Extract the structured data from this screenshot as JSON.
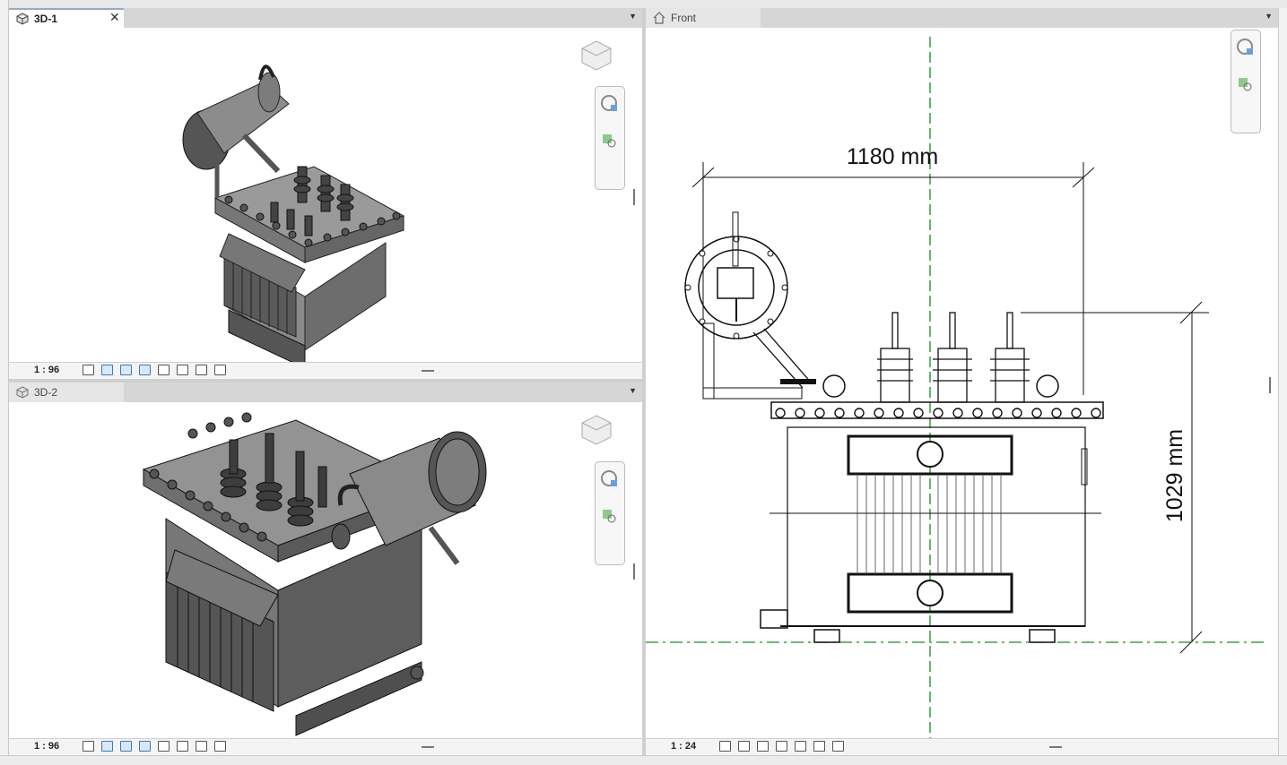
{
  "panes": {
    "top_left": {
      "tab_title": "3D-1",
      "scale": "1 : 96"
    },
    "bottom_left": {
      "tab_title": "3D-2",
      "scale": "1 : 96"
    },
    "right": {
      "tab_title": "Front",
      "scale": "1 : 24"
    }
  },
  "drawing": {
    "width_dimension": "1180 mm",
    "height_dimension": "1029 mm"
  },
  "icons": [
    "3d-view-icon",
    "front-view-icon",
    "close-icon",
    "view-cube-icon",
    "steering-wheel-icon",
    "zoom-icon"
  ],
  "colors": {
    "tab_active_border": "#99aabb",
    "grid_line": "#1a8a1a",
    "model_gray": "#7a7a7a"
  }
}
